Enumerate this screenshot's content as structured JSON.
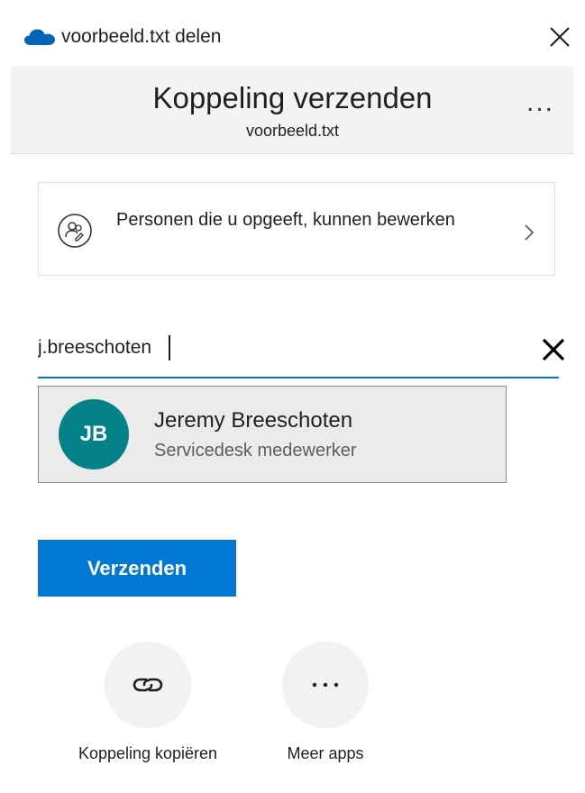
{
  "window": {
    "title": "voorbeeld.txt delen"
  },
  "header": {
    "title": "Koppeling verzenden",
    "subtitle": "voorbeeld.txt",
    "more_label": "..."
  },
  "permission": {
    "text": "Personen die u opgeeft, kunnen bewerken"
  },
  "recipient_search": {
    "value": "j.breeschoten"
  },
  "suggestion": {
    "initials": "JB",
    "name": "Jeremy Breeschoten",
    "role": "Servicedesk medewerker"
  },
  "send_button": {
    "label": "Verzenden"
  },
  "actions": [
    {
      "label": "Koppeling kopiëren",
      "icon": "link-icon"
    },
    {
      "label": "Meer apps",
      "icon": "more-horizontal-icon"
    }
  ],
  "colors": {
    "accent": "#0078d4",
    "avatar": "#038387",
    "header_bg": "#f4f3f2",
    "suggestion_bg": "#ebebeb"
  }
}
